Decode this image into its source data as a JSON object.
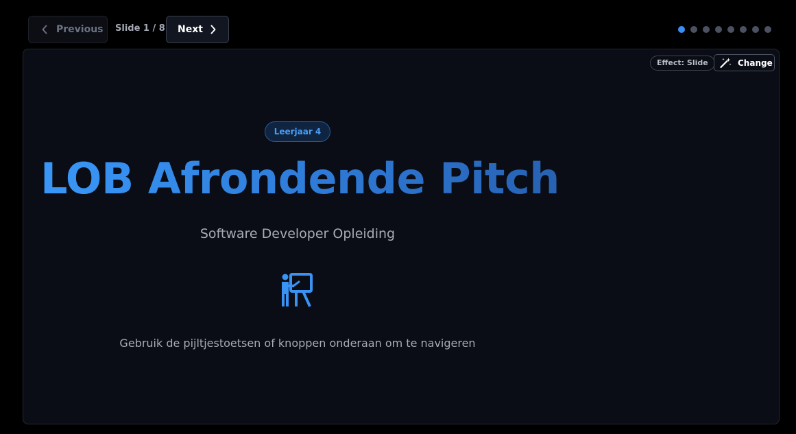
{
  "navigation": {
    "previous_label": "Previous",
    "next_label": "Next",
    "slide_counter": "Slide 1 / 8",
    "current_slide": 1,
    "total_slides": 8
  },
  "slide_controls": {
    "effect_label": "Effect: Slide",
    "change_label": "Change"
  },
  "slide": {
    "badge": "Leerjaar 4",
    "title": "LOB Afrondende Pitch",
    "subtitle": "Software Developer Opleiding",
    "icon": "presenter-icon",
    "hint": "Gebruik de pijltjestoetsen of knoppen onderaan om te navigeren"
  },
  "colors": {
    "accent": "#3b8ff0",
    "background": "#000000",
    "slide_background": "#0a0d15",
    "inactive_dot": "#4b5160"
  }
}
